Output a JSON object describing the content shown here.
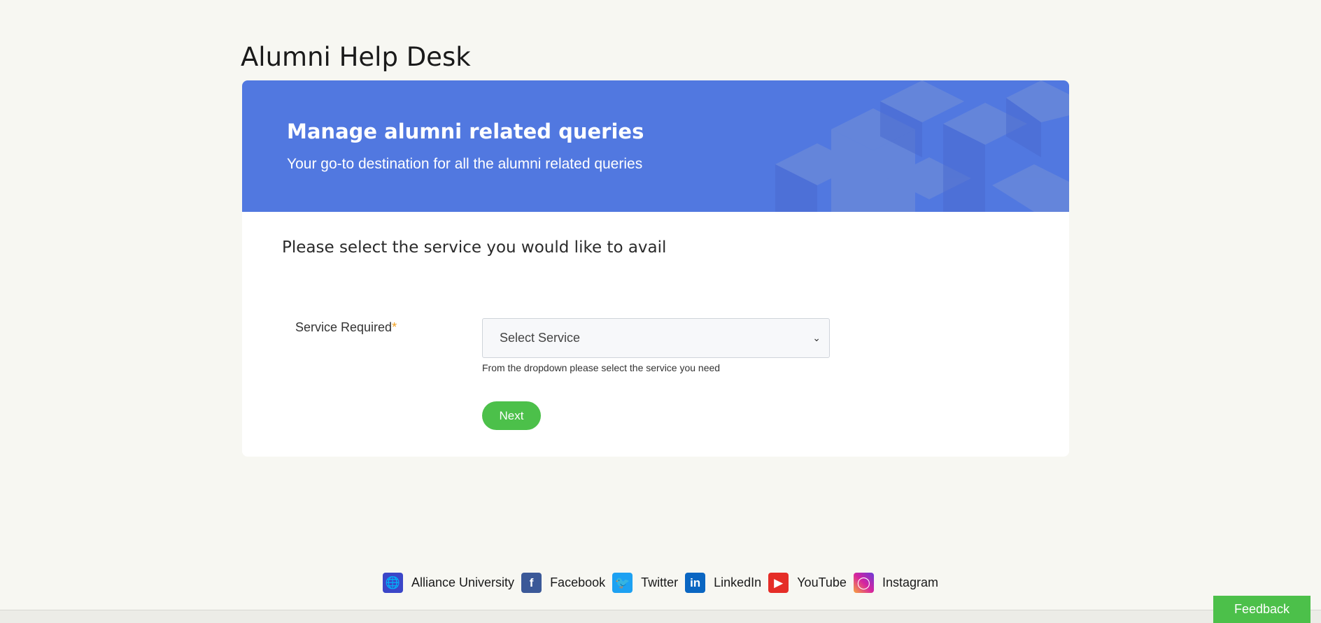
{
  "page": {
    "title": "Alumni Help Desk"
  },
  "banner": {
    "title": "Manage alumni related queries",
    "subtitle": "Your go-to destination for all the alumni related queries"
  },
  "form": {
    "heading": "Please select the service you would like to avail",
    "field_label": "Service Required",
    "required_mark": "*",
    "select_value": "Select Service",
    "help_text": "From the dropdown please select the service you need",
    "next_label": "Next"
  },
  "footer": {
    "links": [
      {
        "label": "Alliance University",
        "icon": "globe-icon",
        "color": "#3b46c8"
      },
      {
        "label": "Facebook",
        "icon": "facebook-icon",
        "color": "#3b5998"
      },
      {
        "label": "Twitter",
        "icon": "twitter-icon",
        "color": "#1da1f2"
      },
      {
        "label": "LinkedIn",
        "icon": "linkedin-icon",
        "color": "#0a66c2"
      },
      {
        "label": "YouTube",
        "icon": "youtube-icon",
        "color": "#e52d27"
      },
      {
        "label": "Instagram",
        "icon": "instagram-icon",
        "color": "#c13584"
      }
    ]
  },
  "feedback_label": "Feedback",
  "colors": {
    "banner": "#5178e0",
    "accent_green": "#4cc04a",
    "required": "#f0a020"
  }
}
